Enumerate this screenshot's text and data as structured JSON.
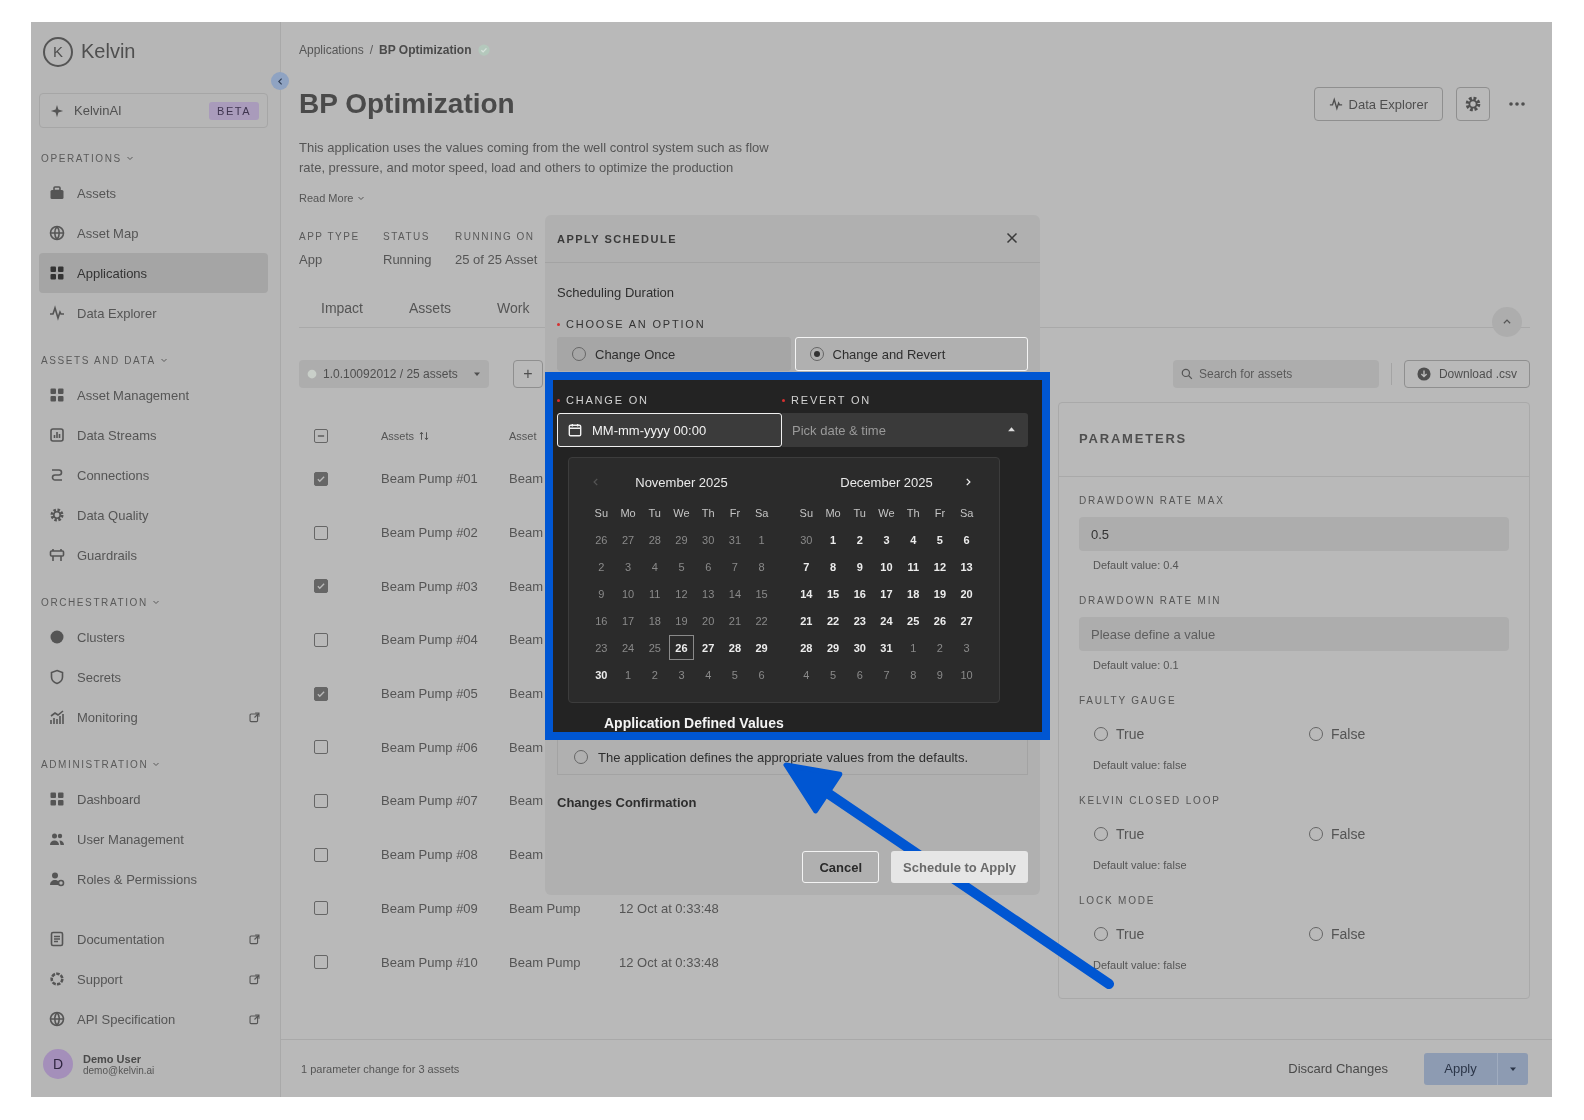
{
  "sidebar": {
    "logo_mark": "K",
    "logo": "Kelvin",
    "assistant": {
      "label": "KelvinAI",
      "badge": "BETA"
    },
    "sections": [
      {
        "title": "OPERATIONS",
        "expanded": true,
        "items": [
          {
            "label": "Assets",
            "selected": false,
            "external": false
          },
          {
            "label": "Asset Map",
            "selected": false,
            "external": false
          },
          {
            "label": "Applications",
            "selected": true,
            "external": false
          },
          {
            "label": "Data Explorer",
            "selected": false,
            "external": false
          }
        ]
      },
      {
        "title": "ASSETS AND DATA",
        "expanded": true,
        "items": [
          {
            "label": "Asset Management",
            "selected": false,
            "external": false
          },
          {
            "label": "Data Streams",
            "selected": false,
            "external": false
          },
          {
            "label": "Connections",
            "selected": false,
            "external": false
          },
          {
            "label": "Data Quality",
            "selected": false,
            "external": false
          },
          {
            "label": "Guardrails",
            "selected": false,
            "external": false
          }
        ]
      },
      {
        "title": "ORCHESTRATION",
        "expanded": true,
        "items": [
          {
            "label": "Clusters",
            "selected": false,
            "external": false
          },
          {
            "label": "Secrets",
            "selected": false,
            "external": false
          },
          {
            "label": "Monitoring",
            "selected": false,
            "external": true
          }
        ]
      },
      {
        "title": "ADMINISTRATION",
        "expanded": true,
        "items": [
          {
            "label": "Dashboard",
            "selected": false,
            "external": false
          },
          {
            "label": "User Management",
            "selected": false,
            "external": false
          },
          {
            "label": "Roles & Permissions",
            "selected": false,
            "external": false
          }
        ]
      },
      {
        "items": [
          {
            "label": "Documentation",
            "selected": false,
            "external": true
          },
          {
            "label": "Support",
            "selected": false,
            "external": true
          },
          {
            "label": "API Specification",
            "selected": false,
            "external": true
          }
        ]
      }
    ],
    "user": {
      "initial": "D",
      "name": "Demo User",
      "email": "demo@kelvin.ai"
    }
  },
  "header": {
    "breadcrumb": [
      "Applications",
      "BP Optimization"
    ],
    "separator": "/",
    "verified": true,
    "title": "BP Optimization",
    "data_explorer": "Data Explorer",
    "description": "This application uses the values coming from the well control system such as flow rate, pressure, and motor speed, load and others to optimize the production",
    "read_more": "Read More",
    "meta": [
      {
        "label": "APP TYPE",
        "value": "App"
      },
      {
        "label": "STATUS",
        "value": "Running"
      },
      {
        "label": "RUNNING ON",
        "value": "25 of 25 Asset"
      }
    ],
    "tabs": [
      "Impact",
      "Assets",
      "Work"
    ]
  },
  "toolbar": {
    "version": "1.0.10092012 / 25 assets",
    "add": "+",
    "search_placeholder": "Search for assets",
    "download": "Download .csv"
  },
  "table": {
    "header_checkbox": {
      "indeterminate": true
    },
    "columns": [
      "Assets",
      "Asset"
    ],
    "rows": [
      {
        "checked": true,
        "cells": [
          "Beam Pump #01",
          "Beam"
        ]
      },
      {
        "checked": false,
        "cells": [
          "Beam Pump #02",
          "Beam"
        ]
      },
      {
        "checked": true,
        "cells": [
          "Beam Pump #03",
          "Beam"
        ]
      },
      {
        "checked": false,
        "cells": [
          "Beam Pump #04",
          "Beam"
        ]
      },
      {
        "checked": true,
        "cells": [
          "Beam Pump #05",
          "Beam"
        ]
      },
      {
        "checked": false,
        "cells": [
          "Beam Pump #06",
          "Beam"
        ]
      },
      {
        "checked": false,
        "cells": [
          "Beam Pump #07",
          "Beam"
        ]
      },
      {
        "checked": false,
        "cells": [
          "Beam Pump #08",
          "Beam"
        ]
      },
      {
        "checked": false,
        "cells": [
          "Beam Pump #09",
          "Beam Pump",
          "12 Oct at 0:33:48"
        ]
      },
      {
        "checked": false,
        "cells": [
          "Beam Pump #10",
          "Beam Pump",
          "12 Oct at 0:33:48"
        ]
      }
    ]
  },
  "parameters": {
    "title": "PARAMETERS",
    "fields": [
      {
        "kind": "number",
        "label": "DRAWDOWN RATE MAX",
        "value": "0.5",
        "hint": "Default value: 0.4"
      },
      {
        "kind": "number",
        "label": "DRAWDOWN RATE MIN",
        "placeholder": "Please define a value",
        "hint": "Default value: 0.1"
      },
      {
        "kind": "boolean",
        "label": "FAULTY GAUGE",
        "options": [
          {
            "label": "True",
            "selected": false
          },
          {
            "label": "False",
            "selected": false
          }
        ],
        "hint": "Default value: false"
      },
      {
        "kind": "boolean",
        "label": "KELVIN CLOSED LOOP",
        "options": [
          {
            "label": "True",
            "selected": false
          },
          {
            "label": "False",
            "selected": false
          }
        ],
        "hint": "Default value: false"
      },
      {
        "kind": "boolean",
        "label": "LOCK MODE",
        "options": [
          {
            "label": "True",
            "selected": false
          },
          {
            "label": "False",
            "selected": false
          }
        ],
        "hint": "Default value: false"
      }
    ]
  },
  "footer": {
    "summary": "1 parameter change for 3 assets",
    "discard": "Discard Changes",
    "apply": "Apply"
  },
  "dialog": {
    "title": "APPLY SCHEDULE",
    "section_title": "Scheduling Duration",
    "choose_label": "CHOOSE AN OPTION",
    "choose_required": true,
    "options": [
      {
        "label": "Change Once",
        "selected": false
      },
      {
        "label": "Change and Revert",
        "selected": true
      }
    ],
    "change_on": {
      "label": "CHANGE ON",
      "required": true,
      "value": "MM-mm-yyyy 00:00"
    },
    "revert_on": {
      "label": "REVERT ON",
      "required": true,
      "placeholder": "Pick date & time",
      "open": true
    },
    "calendar": {
      "months": [
        {
          "title": "November 2025",
          "weekdays": [
            "Su",
            "Mo",
            "Tu",
            "We",
            "Th",
            "Fr",
            "Sa"
          ],
          "nav": {
            "kind": "prev",
            "disabled": true
          },
          "weeks": [
            [
              {
                "label": "26",
                "disabled": true,
                "today": false
              },
              {
                "label": "27",
                "disabled": true,
                "today": false
              },
              {
                "label": "28",
                "disabled": true,
                "today": false
              },
              {
                "label": "29",
                "disabled": true,
                "today": false
              },
              {
                "label": "30",
                "disabled": true,
                "today": false
              },
              {
                "label": "31",
                "disabled": true,
                "today": false
              },
              {
                "label": "1",
                "disabled": true,
                "today": false
              }
            ],
            [
              {
                "label": "2",
                "disabled": true,
                "today": false
              },
              {
                "label": "3",
                "disabled": true,
                "today": false
              },
              {
                "label": "4",
                "disabled": true,
                "today": false
              },
              {
                "label": "5",
                "disabled": true,
                "today": false
              },
              {
                "label": "6",
                "disabled": true,
                "today": false
              },
              {
                "label": "7",
                "disabled": true,
                "today": false
              },
              {
                "label": "8",
                "disabled": true,
                "today": false
              }
            ],
            [
              {
                "label": "9",
                "disabled": true,
                "today": false
              },
              {
                "label": "10",
                "disabled": true,
                "today": false
              },
              {
                "label": "11",
                "disabled": true,
                "today": false
              },
              {
                "label": "12",
                "disabled": true,
                "today": false
              },
              {
                "label": "13",
                "disabled": true,
                "today": false
              },
              {
                "label": "14",
                "disabled": true,
                "today": false
              },
              {
                "label": "15",
                "disabled": true,
                "today": false
              }
            ],
            [
              {
                "label": "16",
                "disabled": true,
                "today": false
              },
              {
                "label": "17",
                "disabled": true,
                "today": false
              },
              {
                "label": "18",
                "disabled": true,
                "today": false
              },
              {
                "label": "19",
                "disabled": true,
                "today": false
              },
              {
                "label": "20",
                "disabled": true,
                "today": false
              },
              {
                "label": "21",
                "disabled": true,
                "today": false
              },
              {
                "label": "22",
                "disabled": true,
                "today": false
              }
            ],
            [
              {
                "label": "23",
                "disabled": true,
                "today": false
              },
              {
                "label": "24",
                "disabled": true,
                "today": false
              },
              {
                "label": "25",
                "disabled": true,
                "today": false
              },
              {
                "label": "26",
                "disabled": false,
                "today": true
              },
              {
                "label": "27",
                "disabled": false,
                "today": false
              },
              {
                "label": "28",
                "disabled": false,
                "today": false
              },
              {
                "label": "29",
                "disabled": false,
                "today": false
              }
            ],
            [
              {
                "label": "30",
                "disabled": false,
                "today": false
              },
              {
                "label": "1",
                "disabled": true,
                "today": false
              },
              {
                "label": "2",
                "disabled": true,
                "today": false
              },
              {
                "label": "3",
                "disabled": true,
                "today": false
              },
              {
                "label": "4",
                "disabled": true,
                "today": false
              },
              {
                "label": "5",
                "disabled": true,
                "today": false
              },
              {
                "label": "6",
                "disabled": true,
                "today": false
              }
            ]
          ]
        },
        {
          "title": "December 2025",
          "weekdays": [
            "Su",
            "Mo",
            "Tu",
            "We",
            "Th",
            "Fr",
            "Sa"
          ],
          "nav": {
            "kind": "next",
            "disabled": false
          },
          "weeks": [
            [
              {
                "label": "30",
                "disabled": true,
                "today": false
              },
              {
                "label": "1",
                "disabled": false,
                "today": false
              },
              {
                "label": "2",
                "disabled": false,
                "today": false
              },
              {
                "label": "3",
                "disabled": false,
                "today": false
              },
              {
                "label": "4",
                "disabled": false,
                "today": false
              },
              {
                "label": "5",
                "disabled": false,
                "today": false
              },
              {
                "label": "6",
                "disabled": false,
                "today": false
              }
            ],
            [
              {
                "label": "7",
                "disabled": false,
                "today": false
              },
              {
                "label": "8",
                "disabled": false,
                "today": false
              },
              {
                "label": "9",
                "disabled": false,
                "today": false
              },
              {
                "label": "10",
                "disabled": false,
                "today": false
              },
              {
                "label": "11",
                "disabled": false,
                "today": false
              },
              {
                "label": "12",
                "disabled": false,
                "today": false
              },
              {
                "label": "13",
                "disabled": false,
                "today": false
              }
            ],
            [
              {
                "label": "14",
                "disabled": false,
                "today": false
              },
              {
                "label": "15",
                "disabled": false,
                "today": false
              },
              {
                "label": "16",
                "disabled": false,
                "today": false
              },
              {
                "label": "17",
                "disabled": false,
                "today": false
              },
              {
                "label": "18",
                "disabled": false,
                "today": false
              },
              {
                "label": "19",
                "disabled": false,
                "today": false
              },
              {
                "label": "20",
                "disabled": false,
                "today": false
              }
            ],
            [
              {
                "label": "21",
                "disabled": false,
                "today": false
              },
              {
                "label": "22",
                "disabled": false,
                "today": false
              },
              {
                "label": "23",
                "disabled": false,
                "today": false
              },
              {
                "label": "24",
                "disabled": false,
                "today": false
              },
              {
                "label": "25",
                "disabled": false,
                "today": false
              },
              {
                "label": "26",
                "disabled": false,
                "today": false
              },
              {
                "label": "27",
                "disabled": false,
                "today": false
              }
            ],
            [
              {
                "label": "28",
                "disabled": false,
                "today": false
              },
              {
                "label": "29",
                "disabled": false,
                "today": false
              },
              {
                "label": "30",
                "disabled": false,
                "today": false
              },
              {
                "label": "31",
                "disabled": false,
                "today": false
              },
              {
                "label": "1",
                "disabled": true,
                "today": false
              },
              {
                "label": "2",
                "disabled": true,
                "today": false
              },
              {
                "label": "3",
                "disabled": true,
                "today": false
              }
            ],
            [
              {
                "label": "4",
                "disabled": true,
                "today": false
              },
              {
                "label": "5",
                "disabled": true,
                "today": false
              },
              {
                "label": "6",
                "disabled": true,
                "today": false
              },
              {
                "label": "7",
                "disabled": true,
                "today": false
              },
              {
                "label": "8",
                "disabled": true,
                "today": false
              },
              {
                "label": "9",
                "disabled": true,
                "today": false
              },
              {
                "label": "10",
                "disabled": true,
                "today": false
              }
            ]
          ]
        }
      ]
    },
    "values_option": {
      "title": "Application Defined Values",
      "description": "The application defines the appropriate values from the defaults.",
      "selected": false
    },
    "confirmation_title": "Changes Confirmation",
    "buttons": [
      {
        "label": "Cancel",
        "kind": "secondary",
        "disabled": false
      },
      {
        "label": "Schedule to Apply",
        "kind": "primary",
        "disabled": true
      }
    ]
  }
}
